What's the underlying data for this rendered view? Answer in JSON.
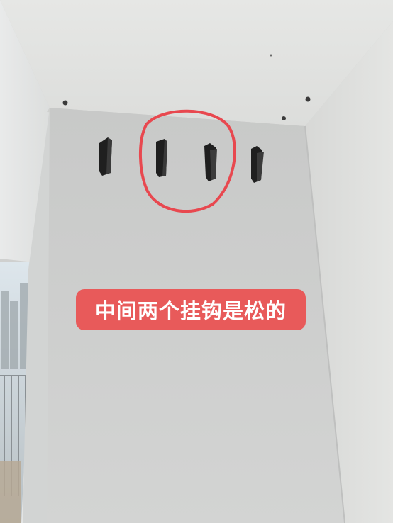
{
  "photo": {
    "caption": "中间两个挂钩是松的",
    "caption_bg_color": "#e85a5a",
    "annotation_color": "#e8484f",
    "hooks": [
      {
        "name": "hook-1",
        "loose": false
      },
      {
        "name": "hook-2",
        "loose": true
      },
      {
        "name": "hook-3",
        "loose": true
      },
      {
        "name": "hook-4",
        "loose": false
      }
    ]
  }
}
